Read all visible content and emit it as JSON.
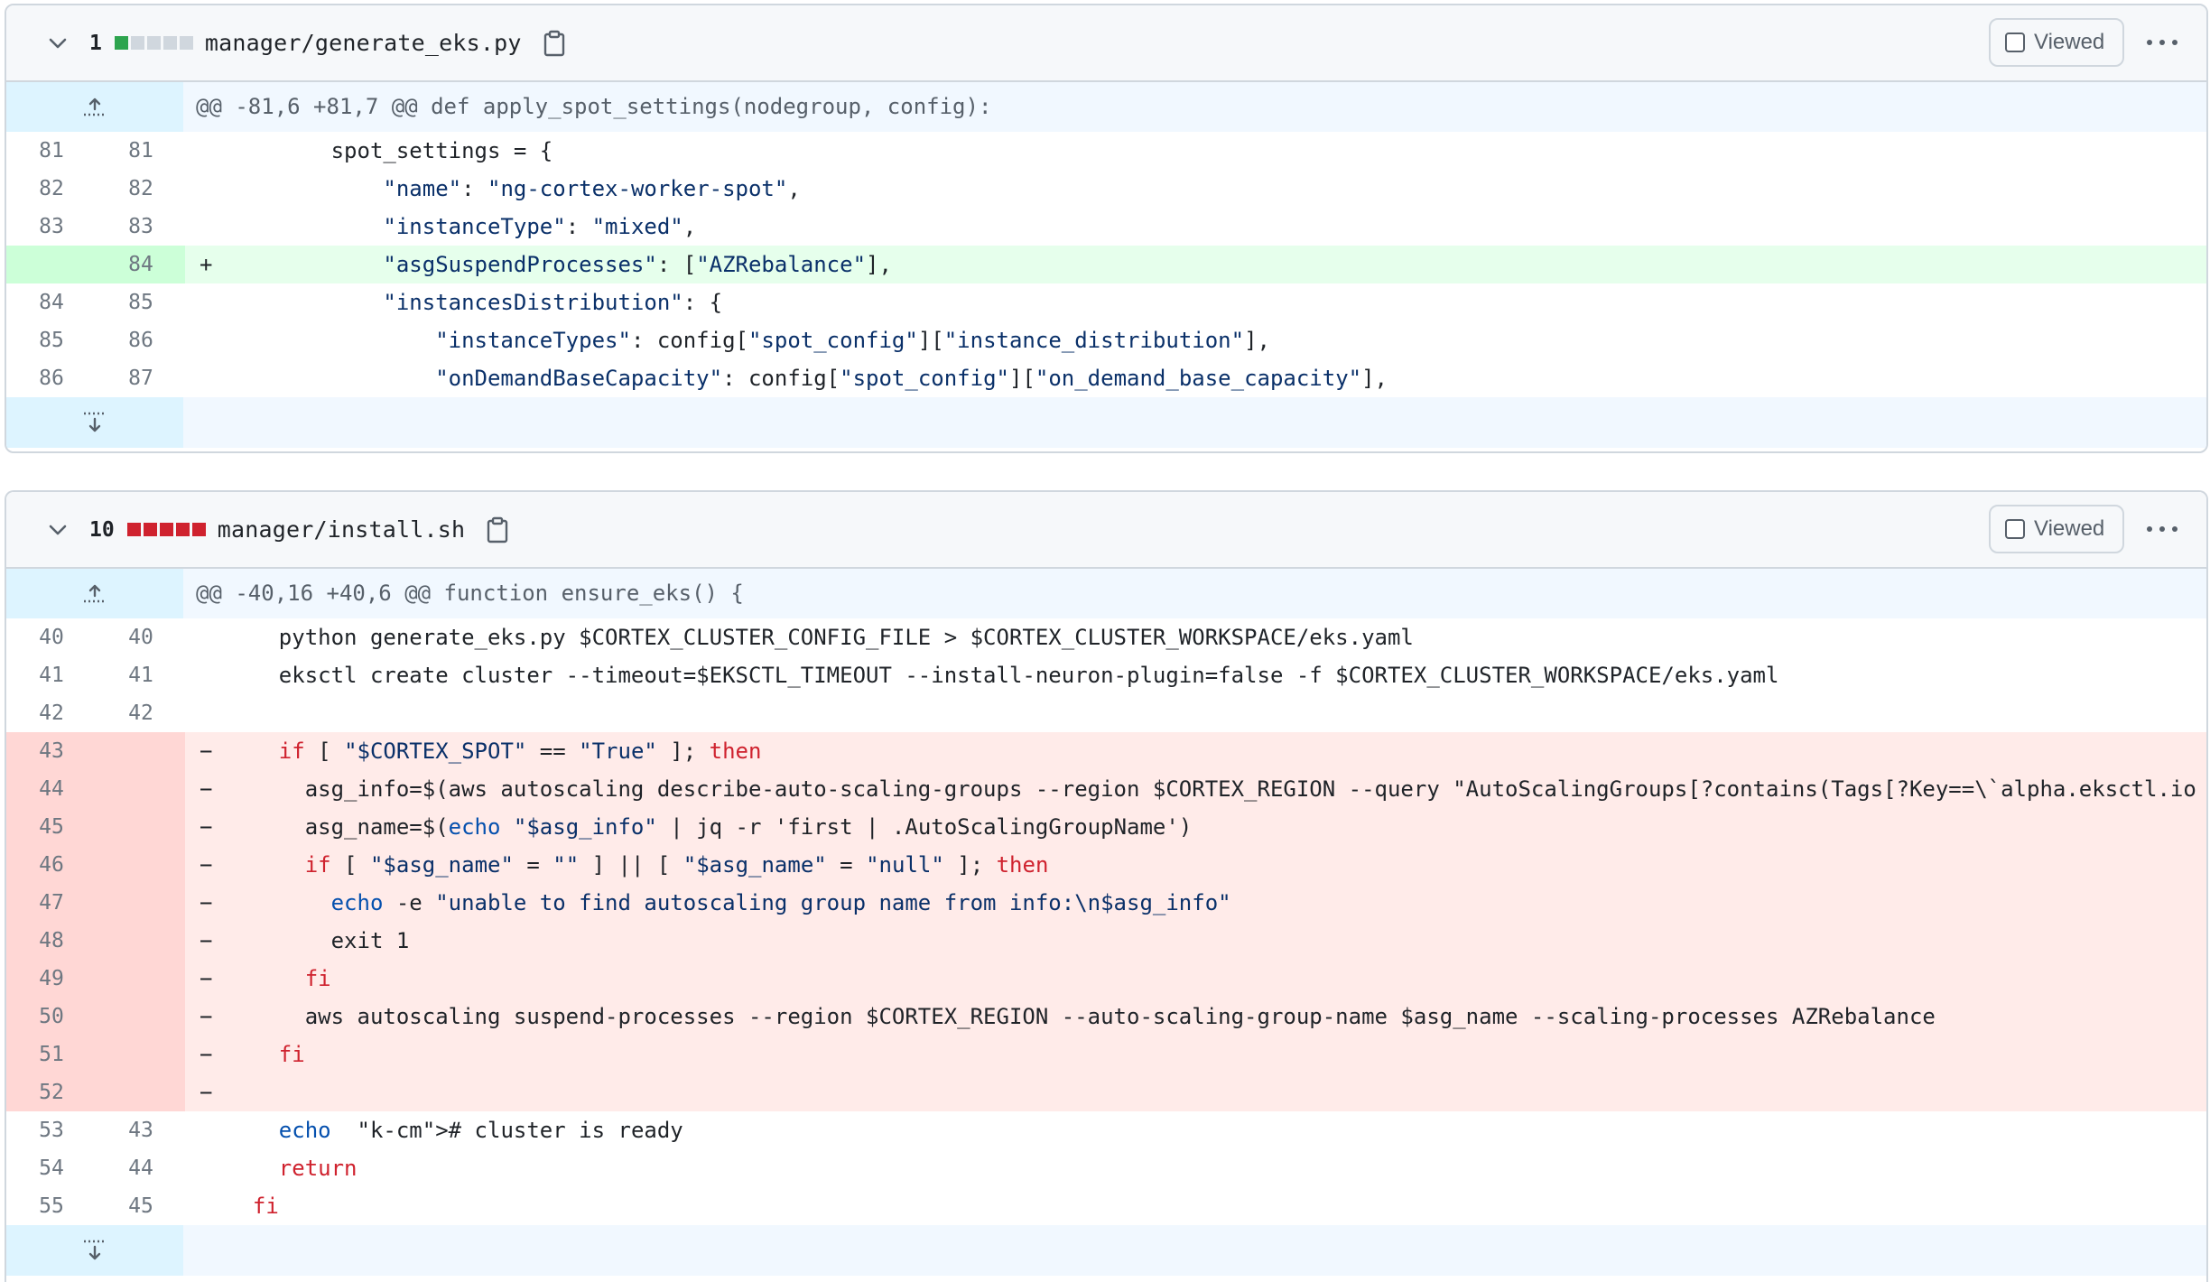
{
  "files": [
    {
      "count": "1",
      "diffstat": [
        "#2da44e",
        "#d0d7de",
        "#d0d7de",
        "#d0d7de",
        "#d0d7de"
      ],
      "filename": "manager/generate_eks.py",
      "viewed_label": "Viewed",
      "hunk_header": "@@ -81,6 +81,7 @@ def apply_spot_settings(nodegroup, config):",
      "lines": [
        {
          "type": "ctx",
          "old": "81",
          "new": "81",
          "sign": "",
          "code": "        spot_settings = {"
        },
        {
          "type": "ctx",
          "old": "82",
          "new": "82",
          "sign": "",
          "code": "            \"name\": \"ng-cortex-worker-spot\","
        },
        {
          "type": "ctx",
          "old": "83",
          "new": "83",
          "sign": "",
          "code": "            \"instanceType\": \"mixed\","
        },
        {
          "type": "add",
          "old": "",
          "new": "84",
          "sign": "+",
          "code": "            \"asgSuspendProcesses\": [\"AZRebalance\"],"
        },
        {
          "type": "ctx",
          "old": "84",
          "new": "85",
          "sign": "",
          "code": "            \"instancesDistribution\": {"
        },
        {
          "type": "ctx",
          "old": "85",
          "new": "86",
          "sign": "",
          "code": "                \"instanceTypes\": config[\"spot_config\"][\"instance_distribution\"],"
        },
        {
          "type": "ctx",
          "old": "86",
          "new": "87",
          "sign": "",
          "code": "                \"onDemandBaseCapacity\": config[\"spot_config\"][\"on_demand_base_capacity\"],"
        }
      ]
    },
    {
      "count": "10",
      "diffstat": [
        "#cf222e",
        "#cf222e",
        "#cf222e",
        "#cf222e",
        "#cf222e"
      ],
      "filename": "manager/install.sh",
      "viewed_label": "Viewed",
      "hunk_header": "@@ -40,16 +40,6 @@ function ensure_eks() {",
      "lines": [
        {
          "type": "ctx",
          "old": "40",
          "new": "40",
          "sign": "",
          "code": "    python generate_eks.py $CORTEX_CLUSTER_CONFIG_FILE > $CORTEX_CLUSTER_WORKSPACE/eks.yaml"
        },
        {
          "type": "ctx",
          "old": "41",
          "new": "41",
          "sign": "",
          "code": "    eksctl create cluster --timeout=$EKSCTL_TIMEOUT --install-neuron-plugin=false -f $CORTEX_CLUSTER_WORKSPACE/eks.yaml"
        },
        {
          "type": "ctx",
          "old": "42",
          "new": "42",
          "sign": "",
          "code": ""
        },
        {
          "type": "del",
          "old": "43",
          "new": "",
          "sign": "−",
          "code": "    if [ \"$CORTEX_SPOT\" == \"True\" ]; then"
        },
        {
          "type": "del",
          "old": "44",
          "new": "",
          "sign": "−",
          "code": "      asg_info=$(aws autoscaling describe-auto-scaling-groups --region $CORTEX_REGION --query \"AutoScalingGroups[?contains(Tags[?Key==\\`alpha.eksctl.io"
        },
        {
          "type": "del",
          "old": "45",
          "new": "",
          "sign": "−",
          "code": "      asg_name=$(echo \"$asg_info\" | jq -r 'first | .AutoScalingGroupName')"
        },
        {
          "type": "del",
          "old": "46",
          "new": "",
          "sign": "−",
          "code": "      if [ \"$asg_name\" = \"\" ] || [ \"$asg_name\" = \"null\" ]; then"
        },
        {
          "type": "del",
          "old": "47",
          "new": "",
          "sign": "−",
          "code": "        echo -e \"unable to find autoscaling group name from info:\\n$asg_info\""
        },
        {
          "type": "del",
          "old": "48",
          "new": "",
          "sign": "−",
          "code": "        exit 1"
        },
        {
          "type": "del",
          "old": "49",
          "new": "",
          "sign": "−",
          "code": "      fi"
        },
        {
          "type": "del",
          "old": "50",
          "new": "",
          "sign": "−",
          "code": "      aws autoscaling suspend-processes --region $CORTEX_REGION --auto-scaling-group-name $asg_name --scaling-processes AZRebalance"
        },
        {
          "type": "del",
          "old": "51",
          "new": "",
          "sign": "−",
          "code": "    fi"
        },
        {
          "type": "del",
          "old": "52",
          "new": "",
          "sign": "−",
          "code": ""
        },
        {
          "type": "ctx",
          "old": "53",
          "new": "43",
          "sign": "",
          "code": "    echo  # cluster is ready"
        },
        {
          "type": "ctx",
          "old": "54",
          "new": "44",
          "sign": "",
          "code": "    return"
        },
        {
          "type": "ctx",
          "old": "55",
          "new": "45",
          "sign": "",
          "code": "  fi"
        }
      ]
    }
  ]
}
